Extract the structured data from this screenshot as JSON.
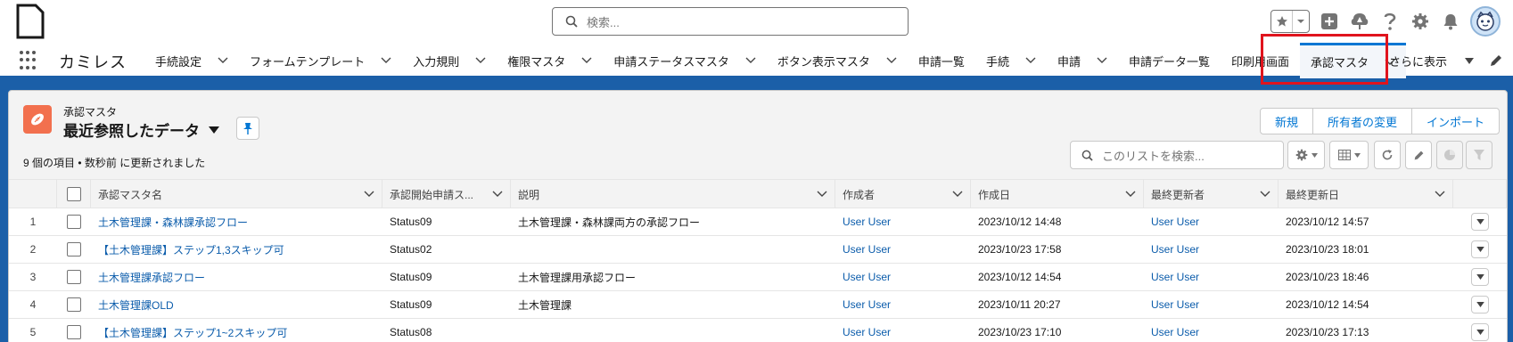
{
  "header": {
    "search_placeholder": "検索...",
    "icons": [
      "file-icon",
      "search-icon",
      "star-icon",
      "add-icon",
      "trailhead-icon",
      "help-icon",
      "gear-icon",
      "bell-icon",
      "avatar"
    ]
  },
  "nav": {
    "app_name": "カミレス",
    "items": [
      {
        "label": "手続設定"
      },
      {
        "label": "フォームテンプレート"
      },
      {
        "label": "入力規則"
      },
      {
        "label": "権限マスタ"
      },
      {
        "label": "申請ステータスマスタ"
      },
      {
        "label": "ボタン表示マスタ"
      },
      {
        "label": "申請一覧"
      },
      {
        "label": "手続"
      },
      {
        "label": "申請"
      },
      {
        "label": "申請データ一覧"
      },
      {
        "label": "印刷用画面"
      },
      {
        "label": "承認マスタ"
      }
    ],
    "more_label": "さらに表示",
    "active_item": "承認マスタ",
    "highlight_color": "#e0141d"
  },
  "list": {
    "object_label": "承認マスタ",
    "view_name": "最近参照したデータ",
    "status": "9 個の項目 • 数秒前 に更新されました",
    "buttons": {
      "new": "新規",
      "change_owner": "所有者の変更",
      "import": "インポート"
    },
    "search_placeholder": "このリストを検索..."
  },
  "table": {
    "columns": [
      "承認マスタ名",
      "承認開始申請ス...",
      "説明",
      "作成者",
      "作成日",
      "最終更新者",
      "最終更新日"
    ],
    "rows": [
      {
        "num": "1",
        "name": "土木管理課・森林課承認フロー",
        "status": "Status09",
        "desc": "土木管理課・森林課両方の承認フロー",
        "creator": "User User",
        "created": "2023/10/12 14:48",
        "modifier": "User User",
        "modified": "2023/10/12 14:57"
      },
      {
        "num": "2",
        "name": "【土木管理課】ステップ1,3スキップ可",
        "status": "Status02",
        "desc": "",
        "creator": "User User",
        "created": "2023/10/23 17:58",
        "modifier": "User User",
        "modified": "2023/10/23 18:01"
      },
      {
        "num": "3",
        "name": "土木管理課承認フロー",
        "status": "Status09",
        "desc": "土木管理課用承認フロー",
        "creator": "User User",
        "created": "2023/10/12 14:54",
        "modifier": "User User",
        "modified": "2023/10/23 18:46"
      },
      {
        "num": "4",
        "name": "土木管理課OLD",
        "status": "Status09",
        "desc": "土木管理課",
        "creator": "User User",
        "created": "2023/10/11 20:27",
        "modifier": "User User",
        "modified": "2023/10/12 14:54"
      },
      {
        "num": "5",
        "name": "【土木管理課】ステップ1~2スキップ可",
        "status": "Status08",
        "desc": "",
        "creator": "User User",
        "created": "2023/10/23 17:10",
        "modifier": "User User",
        "modified": "2023/10/23 17:13"
      }
    ]
  },
  "colors": {
    "brand_blue": "#1b5fa8",
    "link": "#0b5cab",
    "object_icon": "#f2704e"
  }
}
